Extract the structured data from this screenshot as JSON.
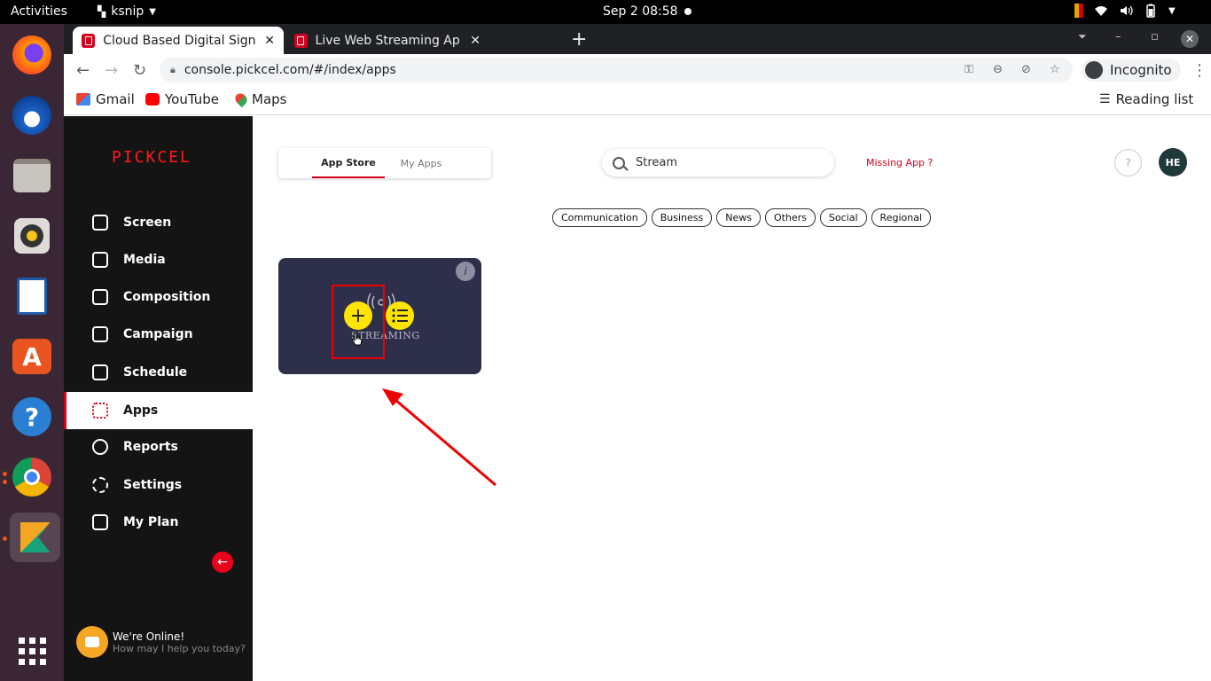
{
  "os": {
    "activities": "Activities",
    "app_name": "ksnip",
    "clock": "Sep 2  08:58"
  },
  "browser": {
    "tabs": [
      {
        "title": "Cloud Based Digital Signa",
        "active": true
      },
      {
        "title": "Live Web Streaming App -",
        "active": false
      }
    ],
    "url": "console.pickcel.com/#/index/apps",
    "incognito_label": "Incognito",
    "bookmarks": [
      "Gmail",
      "YouTube",
      "Maps"
    ],
    "reading_list": "Reading list"
  },
  "sidebar": {
    "logo": "PICKCEL",
    "items": [
      {
        "label": "Screen"
      },
      {
        "label": "Media"
      },
      {
        "label": "Composition"
      },
      {
        "label": "Campaign"
      },
      {
        "label": "Schedule"
      },
      {
        "label": "Apps",
        "active": true
      },
      {
        "label": "Reports"
      },
      {
        "label": "Settings"
      },
      {
        "label": "My Plan"
      }
    ],
    "chat_title": "We're Online!",
    "chat_subtitle": "How may I help you today?"
  },
  "content": {
    "tabs": {
      "store": "App Store",
      "mine": "My Apps"
    },
    "search_value": "Stream",
    "missing_app": "Missing App ?",
    "help": "?",
    "avatar": "HE",
    "filters": [
      "Communication",
      "Business",
      "News",
      "Others",
      "Social",
      "Regional"
    ],
    "app_card": {
      "logo_text": "STREAMING",
      "info": "i"
    }
  },
  "colors": {
    "brand": "#d6001c",
    "card": "#2e2f4a",
    "action": "#fde500",
    "sidebar": "#141414"
  }
}
